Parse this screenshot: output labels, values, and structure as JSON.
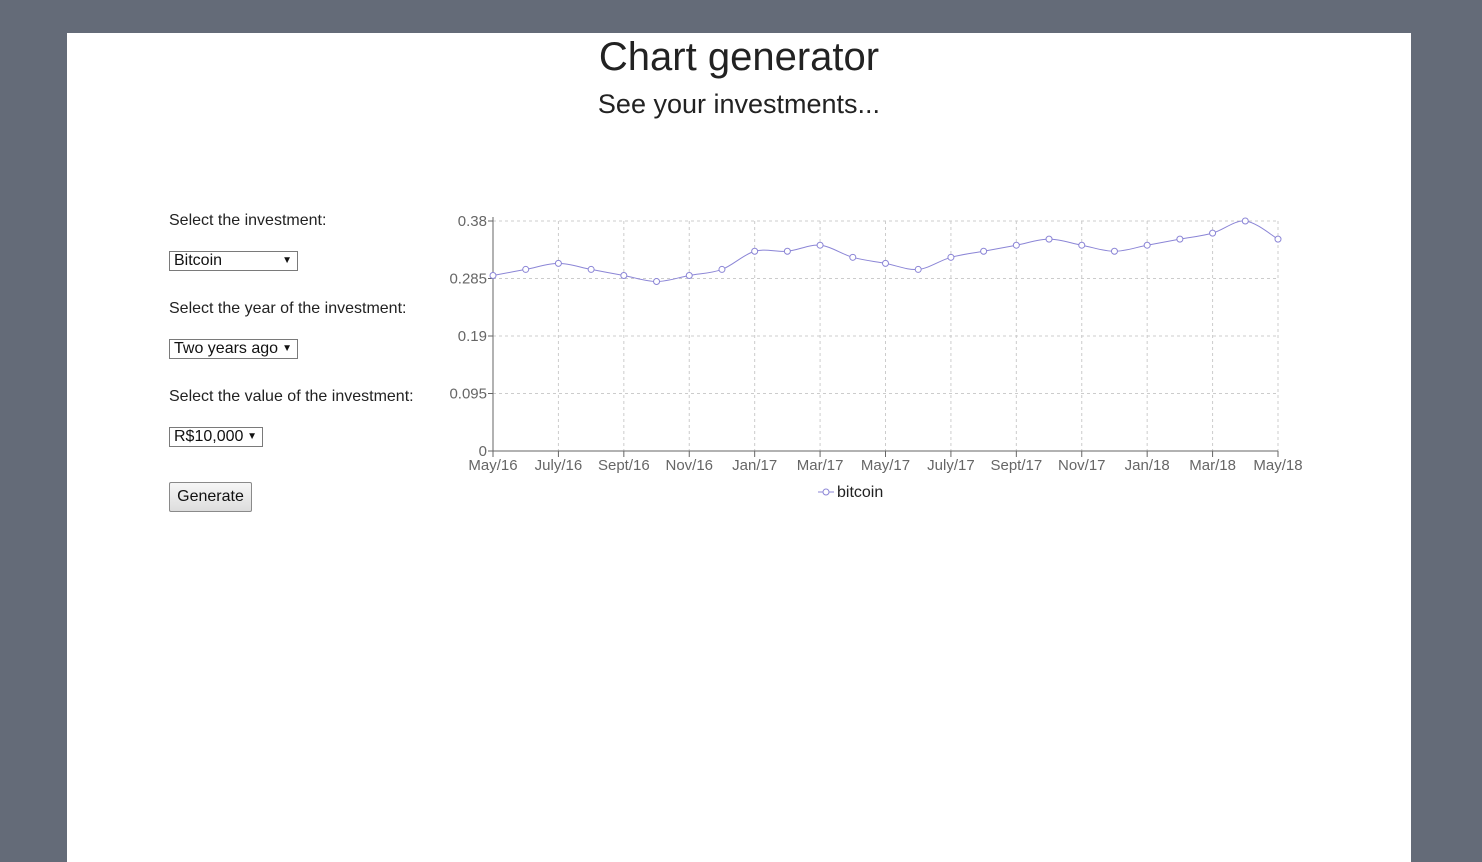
{
  "header": {
    "title": "Chart generator",
    "subtitle": "See your investments..."
  },
  "form": {
    "investment_label": "Select the investment:",
    "investment_value": "Bitcoin",
    "year_label": "Select the year of the investment:",
    "year_value": "Two years ago",
    "value_label": "Select the value of the investment:",
    "value_value": "R$10,000",
    "generate_label": "Generate",
    "dropdown_icon": "chevron-down-icon"
  },
  "chart_data": {
    "type": "line",
    "title": "",
    "xlabel": "",
    "ylabel": "",
    "ylim": [
      0,
      0.38
    ],
    "yticks": [
      "0",
      "0.095",
      "0.19",
      "0.285",
      "0.38"
    ],
    "x_tick_labels": [
      "May/16",
      "July/16",
      "Sept/16",
      "Nov/16",
      "Jan/17",
      "Mar/17",
      "May/17",
      "July/17",
      "Sept/17",
      "Nov/17",
      "Jan/18",
      "Mar/18",
      "May/18"
    ],
    "x": [
      "May/16",
      "Jun/16",
      "July/16",
      "Aug/16",
      "Sept/16",
      "Oct/16",
      "Nov/16",
      "Dec/16",
      "Jan/17",
      "Feb/17",
      "Mar/17",
      "Apr/17",
      "May/17",
      "Jun/17",
      "July/17",
      "Aug/17",
      "Sept/17",
      "Oct/17",
      "Nov/17",
      "Dec/17",
      "Jan/18",
      "Feb/18",
      "Mar/18",
      "Apr/18",
      "May/18"
    ],
    "grid": true,
    "legend_position": "bottom",
    "series": [
      {
        "name": "bitcoin",
        "color": "#8b85d6",
        "values": [
          0.29,
          0.3,
          0.31,
          0.3,
          0.29,
          0.28,
          0.29,
          0.3,
          0.33,
          0.33,
          0.34,
          0.32,
          0.31,
          0.3,
          0.32,
          0.33,
          0.34,
          0.35,
          0.34,
          0.33,
          0.34,
          0.35,
          0.36,
          0.38,
          0.35
        ]
      }
    ]
  }
}
